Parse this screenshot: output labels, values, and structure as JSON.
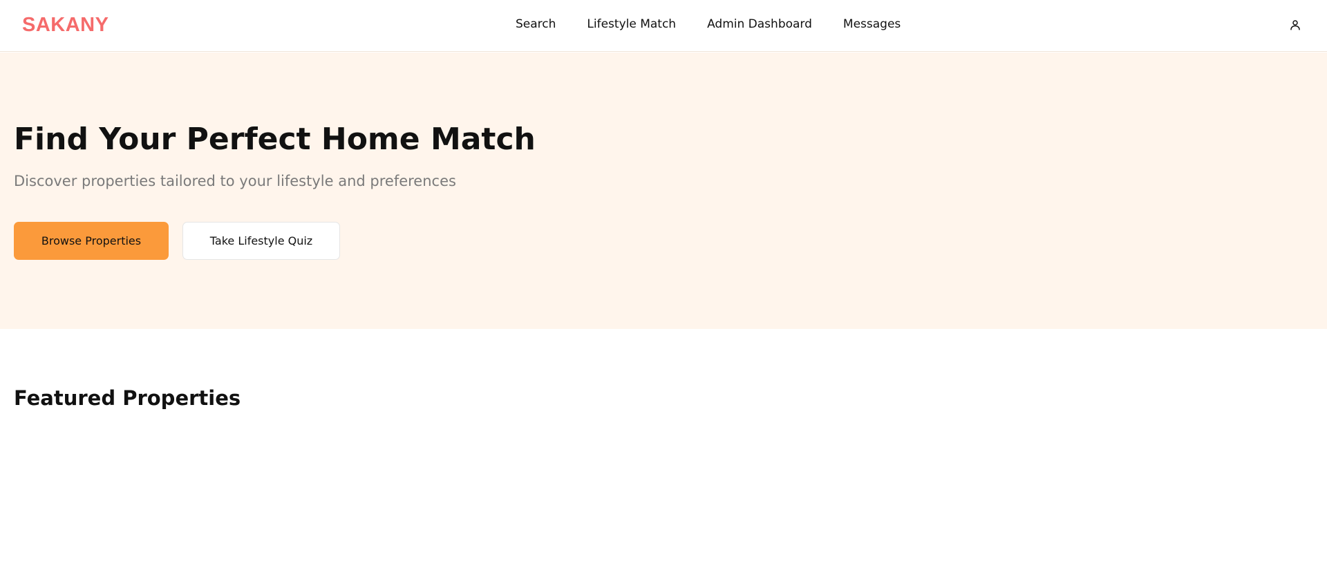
{
  "colors": {
    "brand": "#f56b6b",
    "primary_button": "#fb9a3b",
    "hero_background": "#fff5ec"
  },
  "header": {
    "logo": "SAKANY",
    "nav": [
      {
        "label": "Search"
      },
      {
        "label": "Lifestyle Match"
      },
      {
        "label": "Admin Dashboard"
      },
      {
        "label": "Messages"
      }
    ],
    "user_icon": "user-icon"
  },
  "hero": {
    "title": "Find Your Perfect Home Match",
    "subtitle": "Discover properties tailored to your lifestyle and preferences",
    "primary_button": "Browse Properties",
    "secondary_button": "Take Lifestyle Quiz"
  },
  "featured": {
    "title": "Featured Properties"
  }
}
